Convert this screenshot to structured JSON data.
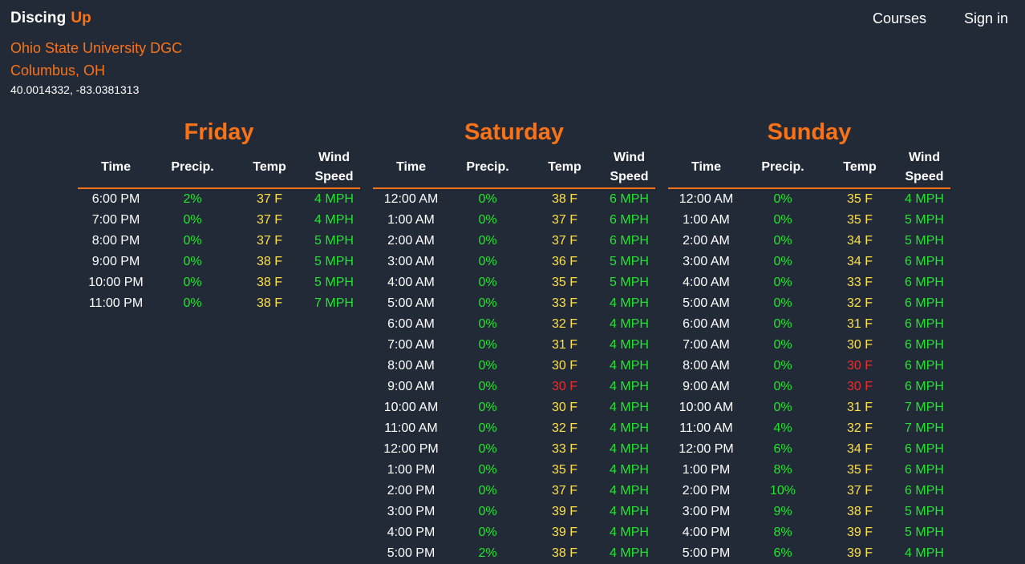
{
  "colors": {
    "background": "#222a38",
    "accent": "#f97316",
    "good": "#22e52e",
    "warm": "#fde047",
    "cold": "#ef2b2b"
  },
  "nav": {
    "brand_first": "Discing",
    "brand_second": "Up",
    "links": [
      "Courses",
      "Sign in"
    ]
  },
  "course": {
    "name": "Ohio State University DGC",
    "location": "Columbus, OH",
    "coordinates": "40.0014332, -83.0381313"
  },
  "table_headers": {
    "time": "Time",
    "precip": "Precip.",
    "temp": "Temp",
    "wind_line1": "Wind",
    "wind_line2": "Speed"
  },
  "days": [
    {
      "name": "Friday",
      "rows": [
        {
          "time": "6:00 PM",
          "precip": "2%",
          "temp": "37 F",
          "temp_status": "yellow",
          "wind": "4 MPH"
        },
        {
          "time": "7:00 PM",
          "precip": "0%",
          "temp": "37 F",
          "temp_status": "yellow",
          "wind": "4 MPH"
        },
        {
          "time": "8:00 PM",
          "precip": "0%",
          "temp": "37 F",
          "temp_status": "yellow",
          "wind": "5 MPH"
        },
        {
          "time": "9:00 PM",
          "precip": "0%",
          "temp": "38 F",
          "temp_status": "yellow",
          "wind": "5 MPH"
        },
        {
          "time": "10:00 PM",
          "precip": "0%",
          "temp": "38 F",
          "temp_status": "yellow",
          "wind": "5 MPH"
        },
        {
          "time": "11:00 PM",
          "precip": "0%",
          "temp": "38 F",
          "temp_status": "yellow",
          "wind": "7 MPH"
        }
      ]
    },
    {
      "name": "Saturday",
      "rows": [
        {
          "time": "12:00 AM",
          "precip": "0%",
          "temp": "38 F",
          "temp_status": "yellow",
          "wind": "6 MPH"
        },
        {
          "time": "1:00 AM",
          "precip": "0%",
          "temp": "37 F",
          "temp_status": "yellow",
          "wind": "6 MPH"
        },
        {
          "time": "2:00 AM",
          "precip": "0%",
          "temp": "37 F",
          "temp_status": "yellow",
          "wind": "6 MPH"
        },
        {
          "time": "3:00 AM",
          "precip": "0%",
          "temp": "36 F",
          "temp_status": "yellow",
          "wind": "5 MPH"
        },
        {
          "time": "4:00 AM",
          "precip": "0%",
          "temp": "35 F",
          "temp_status": "yellow",
          "wind": "5 MPH"
        },
        {
          "time": "5:00 AM",
          "precip": "0%",
          "temp": "33 F",
          "temp_status": "yellow",
          "wind": "4 MPH"
        },
        {
          "time": "6:00 AM",
          "precip": "0%",
          "temp": "32 F",
          "temp_status": "yellow",
          "wind": "4 MPH"
        },
        {
          "time": "7:00 AM",
          "precip": "0%",
          "temp": "31 F",
          "temp_status": "yellow",
          "wind": "4 MPH"
        },
        {
          "time": "8:00 AM",
          "precip": "0%",
          "temp": "30 F",
          "temp_status": "yellow",
          "wind": "4 MPH"
        },
        {
          "time": "9:00 AM",
          "precip": "0%",
          "temp": "30 F",
          "temp_status": "red",
          "wind": "4 MPH"
        },
        {
          "time": "10:00 AM",
          "precip": "0%",
          "temp": "30 F",
          "temp_status": "yellow",
          "wind": "4 MPH"
        },
        {
          "time": "11:00 AM",
          "precip": "0%",
          "temp": "32 F",
          "temp_status": "yellow",
          "wind": "4 MPH"
        },
        {
          "time": "12:00 PM",
          "precip": "0%",
          "temp": "33 F",
          "temp_status": "yellow",
          "wind": "4 MPH"
        },
        {
          "time": "1:00 PM",
          "precip": "0%",
          "temp": "35 F",
          "temp_status": "yellow",
          "wind": "4 MPH"
        },
        {
          "time": "2:00 PM",
          "precip": "0%",
          "temp": "37 F",
          "temp_status": "yellow",
          "wind": "4 MPH"
        },
        {
          "time": "3:00 PM",
          "precip": "0%",
          "temp": "39 F",
          "temp_status": "yellow",
          "wind": "4 MPH"
        },
        {
          "time": "4:00 PM",
          "precip": "0%",
          "temp": "39 F",
          "temp_status": "yellow",
          "wind": "4 MPH"
        },
        {
          "time": "5:00 PM",
          "precip": "2%",
          "temp": "38 F",
          "temp_status": "yellow",
          "wind": "4 MPH"
        }
      ]
    },
    {
      "name": "Sunday",
      "rows": [
        {
          "time": "12:00 AM",
          "precip": "0%",
          "temp": "35 F",
          "temp_status": "yellow",
          "wind": "4 MPH"
        },
        {
          "time": "1:00 AM",
          "precip": "0%",
          "temp": "35 F",
          "temp_status": "yellow",
          "wind": "5 MPH"
        },
        {
          "time": "2:00 AM",
          "precip": "0%",
          "temp": "34 F",
          "temp_status": "yellow",
          "wind": "5 MPH"
        },
        {
          "time": "3:00 AM",
          "precip": "0%",
          "temp": "34 F",
          "temp_status": "yellow",
          "wind": "6 MPH"
        },
        {
          "time": "4:00 AM",
          "precip": "0%",
          "temp": "33 F",
          "temp_status": "yellow",
          "wind": "6 MPH"
        },
        {
          "time": "5:00 AM",
          "precip": "0%",
          "temp": "32 F",
          "temp_status": "yellow",
          "wind": "6 MPH"
        },
        {
          "time": "6:00 AM",
          "precip": "0%",
          "temp": "31 F",
          "temp_status": "yellow",
          "wind": "6 MPH"
        },
        {
          "time": "7:00 AM",
          "precip": "0%",
          "temp": "30 F",
          "temp_status": "yellow",
          "wind": "6 MPH"
        },
        {
          "time": "8:00 AM",
          "precip": "0%",
          "temp": "30 F",
          "temp_status": "red",
          "wind": "6 MPH"
        },
        {
          "time": "9:00 AM",
          "precip": "0%",
          "temp": "30 F",
          "temp_status": "red",
          "wind": "6 MPH"
        },
        {
          "time": "10:00 AM",
          "precip": "0%",
          "temp": "31 F",
          "temp_status": "yellow",
          "wind": "7 MPH"
        },
        {
          "time": "11:00 AM",
          "precip": "4%",
          "temp": "32 F",
          "temp_status": "yellow",
          "wind": "7 MPH"
        },
        {
          "time": "12:00 PM",
          "precip": "6%",
          "temp": "34 F",
          "temp_status": "yellow",
          "wind": "6 MPH"
        },
        {
          "time": "1:00 PM",
          "precip": "8%",
          "temp": "35 F",
          "temp_status": "yellow",
          "wind": "6 MPH"
        },
        {
          "time": "2:00 PM",
          "precip": "10%",
          "temp": "37 F",
          "temp_status": "yellow",
          "wind": "6 MPH"
        },
        {
          "time": "3:00 PM",
          "precip": "9%",
          "temp": "38 F",
          "temp_status": "yellow",
          "wind": "5 MPH"
        },
        {
          "time": "4:00 PM",
          "precip": "8%",
          "temp": "39 F",
          "temp_status": "yellow",
          "wind": "5 MPH"
        },
        {
          "time": "5:00 PM",
          "precip": "6%",
          "temp": "39 F",
          "temp_status": "yellow",
          "wind": "4 MPH"
        }
      ]
    }
  ]
}
